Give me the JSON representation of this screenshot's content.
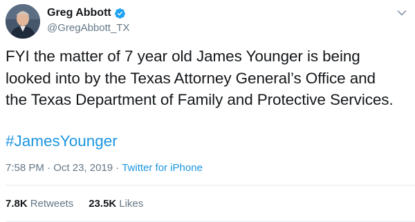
{
  "tweet": {
    "author": {
      "display_name": "Greg Abbott",
      "handle": "@GregAbbott_TX",
      "verified": true,
      "avatar_icon": "profile-photo"
    },
    "text": "FYI the matter of 7 year old James Younger is being\nlooked into by the Texas Attorney General’s Office and\nthe Texas Department of Family and Protective Services.",
    "hashtag": "#JamesYounger",
    "time": "7:58 PM",
    "date": "Oct 23, 2019",
    "separator": "·",
    "source": "Twitter for iPhone",
    "stats": {
      "retweets_count": "7.8K",
      "retweets_label": "Retweets",
      "likes_count": "23.5K",
      "likes_label": "Likes"
    },
    "colors": {
      "link": "#1b95e0",
      "secondary_text": "#657786",
      "primary_text": "#14171a",
      "verified_badge": "#1da1f2"
    }
  }
}
